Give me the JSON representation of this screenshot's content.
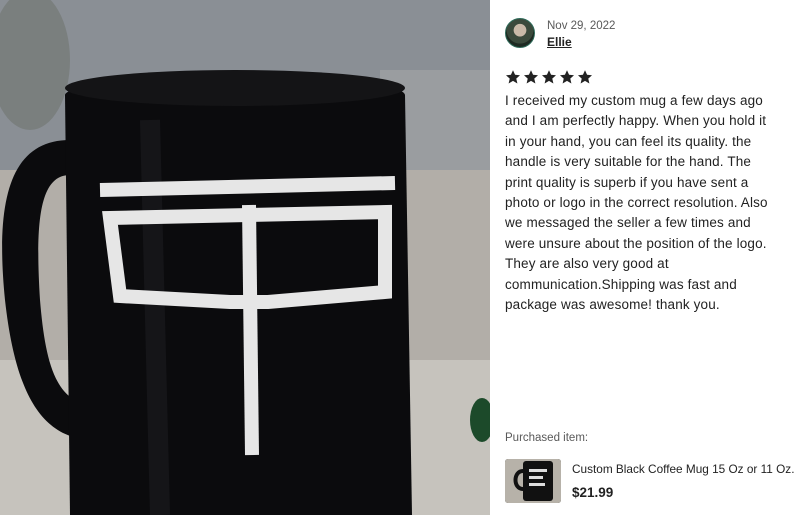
{
  "review": {
    "date": "Nov 29, 2022",
    "reviewer_name": "Ellie",
    "rating": 5,
    "rating_max": 5,
    "text": "I received my custom mug a few days ago\nand I am perfectly happy. When you hold it\nin your hand, you can feel its quality. the\nhandle is very suitable for the hand. The\nprint quality is superb if you have sent a\nphoto or logo in the correct resolution. Also\nwe messaged the seller a few times and\nwere unsure about the position of the logo.\nThey are also very good at\ncommunication.Shipping was fast and\npackage was awesome! thank you."
  },
  "purchased": {
    "label": "Purchased item:",
    "title": "Custom Black Coffee Mug 15 Oz or 11 Oz.",
    "price": "$21.99"
  },
  "icons": {
    "star": "star-icon",
    "avatar": "avatar"
  },
  "colors": {
    "star": "#222222",
    "mug": "#0b0b0d",
    "logo": "#e8e8e8"
  }
}
